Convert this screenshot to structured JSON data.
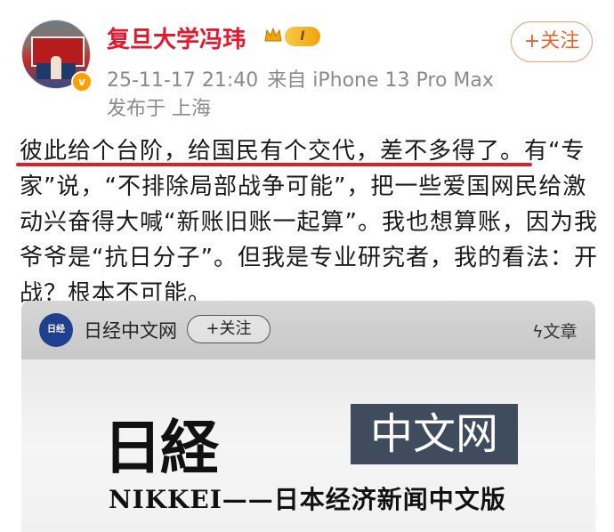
{
  "author": {
    "name": "复旦大学冯玮",
    "level_badge": "I",
    "verify_icon": "verified-v-icon",
    "crown_icon": "crown-icon",
    "timestamp": "25-11-17 21:40",
    "source": "来自 iPhone 13 Pro Max",
    "location": "发布于 上海",
    "follow_label": "+关注"
  },
  "post": {
    "text": "彼此给个台阶，给国民有个交代，差不多得了。有“专家”说，“不排除局部战争可能”，把一些爱国网民给激动兴奋得大喊“新账旧账一起算”。我也想算账，因为我爷爷是“抗日分子”。但我是专业研究者，我的看法：开战？根本不可能。",
    "underline_color": "#d8222a"
  },
  "card": {
    "publisher": "日经中文网",
    "publisher_logo": "日经",
    "follow_label": "+关注",
    "type_label": "ϟ文章",
    "banner_jp": "日経",
    "banner_cn": "中文网",
    "banner_tagline": "NIKKEI——日本经济新闻中文版"
  },
  "colors": {
    "username": "#e6162d",
    "follow_accent": "#e8632d",
    "meta_gray": "#8a8a8a"
  }
}
